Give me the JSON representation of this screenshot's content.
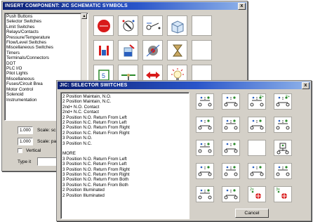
{
  "main_window": {
    "title": "INSERT COMPONENT: JIC SCHEMATIC SYMBOLS",
    "close_label": "x",
    "categories": [
      "Push Buttons",
      "Selector Switches",
      "Limit Switches",
      "Relays/Contacts",
      "Pressure/Temperature",
      "Flow/Level Switches",
      "Miscellaneous Switches",
      "Timers",
      "Terminals/Connectors",
      "DOT",
      "PLC I/O",
      "Pilot Lights",
      "Miscellaneous",
      "Fuses/Circuit Brea",
      "Motor Control",
      "Solenoid",
      "Instrumentation"
    ],
    "scale_symbol_value": "1.000",
    "scale_symbol_label": "Scale: sc",
    "scale_pattern_value": "1.000",
    "scale_pattern_label": "Scale: pa",
    "vertical_label": "Vertical",
    "type_it_label": "Type it",
    "type_it_value": ""
  },
  "dialog": {
    "title": "JIC: SELECTOR SWITCHES",
    "close_label": "x",
    "items": [
      "2 Position Maintain, N.O.",
      "2 Position Maintain, N.C.",
      "2nd+ N.O. Contact",
      "2nd+ N.C. Contact",
      "2 Position N.O. Return From Left",
      "2 Position N.C. Return From Left",
      "2 Position N.O. Return From Right",
      "2 Position N.C. Return From Right",
      "3 Position N.O.",
      "3 Position N.C.",
      "",
      "MORE",
      "3 Position N.O. Return From Left",
      "3 Position N.C. Return From Left",
      "3 Position N.O. Return From Right",
      "3 Position N.C. Return From Right",
      "3 Position N.O. Return From Both",
      "3 Position N.C. Return From Both",
      "2 Position Illuminated",
      "2 Position Illuminated"
    ],
    "tile_tags": {
      "2nd_plus_a": "2+",
      "2nd_plus_b": "2+",
      "two_x_a": "2x",
      "three_x_a": "3x"
    },
    "cancel_label": "Cancel"
  },
  "colors": {
    "title_dark": "#0b1f73",
    "title_light": "#8fb3ea",
    "window_face": "#d4d0c8",
    "symbol_red": "#d81a1a",
    "symbol_green": "#2a8a2a",
    "symbol_blue": "#2a5fbf"
  }
}
